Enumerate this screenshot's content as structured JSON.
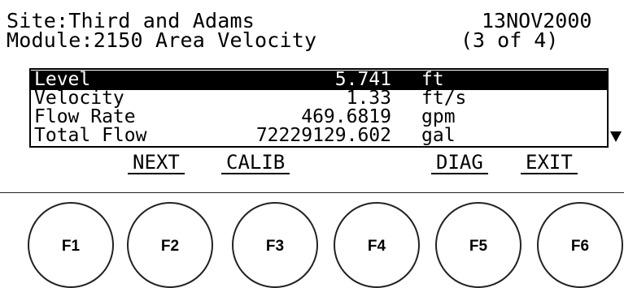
{
  "header": {
    "site": "Site:Third and Adams",
    "date": "13NOV2000",
    "module": "Module:2150 Area Velocity",
    "page": "(3 of 4)"
  },
  "readings": [
    {
      "label": "Level",
      "value": "5.741",
      "unit": "ft",
      "selected": true
    },
    {
      "label": "Velocity",
      "value": "1.33",
      "unit": "ft/s",
      "selected": false
    },
    {
      "label": "Flow Rate",
      "value": "469.6819",
      "unit": "gpm",
      "selected": false
    },
    {
      "label": "Total Flow",
      "value": "72229129.602",
      "unit": "gal",
      "selected": false
    }
  ],
  "softkeys": {
    "next": "NEXT",
    "calib": "CALIB",
    "diag": "DIAG",
    "exit": "EXIT"
  },
  "buttons": [
    "F1",
    "F2",
    "F3",
    "F4",
    "F5",
    "F6"
  ]
}
